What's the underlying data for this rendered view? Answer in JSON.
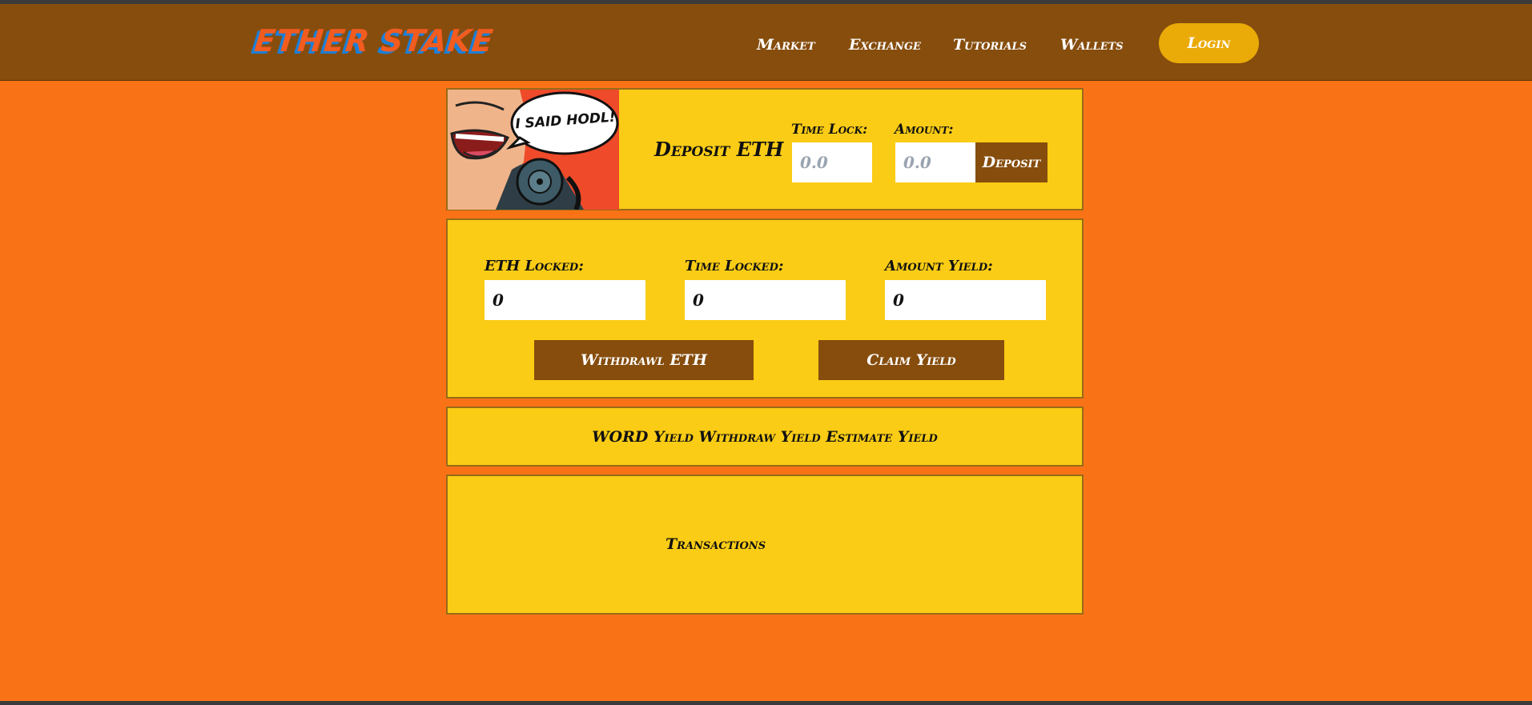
{
  "header": {
    "logo": "ETHER STAKE",
    "nav": [
      {
        "label": "Market"
      },
      {
        "label": "Exchange"
      },
      {
        "label": "Tutorials"
      },
      {
        "label": "Wallets"
      }
    ],
    "login_label": "Login"
  },
  "deposit": {
    "hero_text": "I SAID HODL!",
    "title": "Deposit ETH",
    "time_lock_label": "Time Lock:",
    "time_lock_placeholder": "0.0",
    "amount_label": "Amount:",
    "amount_placeholder": "0.0",
    "deposit_button": "Deposit"
  },
  "stats": {
    "eth_locked_label": "ETH Locked:",
    "eth_locked_value": "0",
    "time_locked_label": "Time Locked:",
    "time_locked_value": "0",
    "amount_yield_label": "Amount Yield:",
    "amount_yield_value": "0",
    "withdraw_button": "Withdrawl ETH",
    "claim_button": "Claim Yield"
  },
  "yield_bar": {
    "text": "WORD Yield Withdraw Yield Estimate Yield"
  },
  "transactions": {
    "title": "Transactions"
  },
  "colors": {
    "page_bg": "#f97316",
    "navbar": "#864d0d",
    "card": "#facc15",
    "button": "#864d0d",
    "login": "#eaaa08"
  }
}
